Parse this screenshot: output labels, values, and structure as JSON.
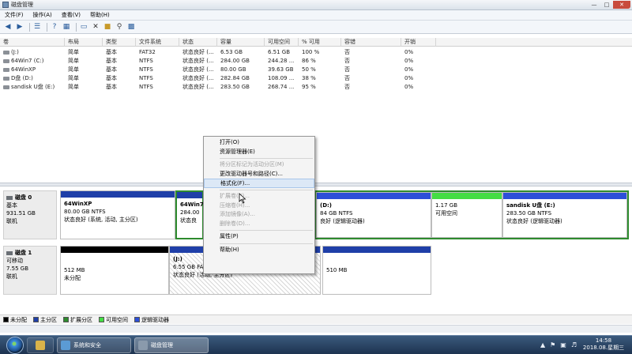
{
  "window": {
    "title": "磁盘管理",
    "controls": [
      "—",
      "□",
      "✕"
    ]
  },
  "menubar": [
    "文件(F)",
    "操作(A)",
    "查看(V)",
    "帮助(H)"
  ],
  "columns": [
    "卷",
    "布局",
    "类型",
    "文件系统",
    "状态",
    "容量",
    "可用空间",
    "% 可用",
    "容错",
    "开销"
  ],
  "volumes": [
    {
      "name": "(J:)",
      "layout": "简单",
      "type": "基本",
      "fs": "FAT32",
      "status": "状态良好 (...",
      "capacity": "6.53 GB",
      "free": "6.51 GB",
      "pct": "100 %",
      "fault": "否",
      "overhead": "0%"
    },
    {
      "name": "64Win7 (C:)",
      "layout": "简单",
      "type": "基本",
      "fs": "NTFS",
      "status": "状态良好 (...",
      "capacity": "284.00 GB",
      "free": "244.28 ...",
      "pct": "86 %",
      "fault": "否",
      "overhead": "0%"
    },
    {
      "name": "64WinXP",
      "layout": "简单",
      "type": "基本",
      "fs": "NTFS",
      "status": "状态良好 (...",
      "capacity": "80.00 GB",
      "free": "39.63 GB",
      "pct": "50 %",
      "fault": "否",
      "overhead": "0%"
    },
    {
      "name": "D盘 (D:)",
      "layout": "简单",
      "type": "基本",
      "fs": "NTFS",
      "status": "状态良好 (...",
      "capacity": "282.84 GB",
      "free": "108.09 ...",
      "pct": "38 %",
      "fault": "否",
      "overhead": "0%"
    },
    {
      "name": "sandisk U盘 (E:)",
      "layout": "简单",
      "type": "基本",
      "fs": "NTFS",
      "status": "状态良好 (...",
      "capacity": "283.50 GB",
      "free": "268.74 ...",
      "pct": "95 %",
      "fault": "否",
      "overhead": "0%"
    }
  ],
  "disk0": {
    "title": "磁盘 0",
    "type": "基本",
    "size": "931.51 GB",
    "state": "联机",
    "parts": [
      {
        "line1": "64WinXP",
        "line2": "80.00 GB NTFS",
        "line3": "状态良好 (系统, 活动, 主分区)"
      },
      {
        "line1": "64Win7",
        "line2": "284.00",
        "line3": "状态良"
      },
      {
        "line1": "(D:)",
        "line2": "84 GB NTFS",
        "line3": "良好 (逻辑驱动器)"
      },
      {
        "line1": "",
        "line2": "1.17 GB",
        "line3": "可用空间"
      },
      {
        "line1": "sandisk U盘  (E:)",
        "line2": "283.50 GB NTFS",
        "line3": "状态良好 (逻辑驱动器)"
      }
    ]
  },
  "disk1": {
    "title": "磁盘 1",
    "type": "可移动",
    "size": "7.55 GB",
    "state": "联机",
    "parts": [
      {
        "line1": "",
        "line2": "512 MB",
        "line3": "未分配"
      },
      {
        "line1": "(J:)",
        "line2": "6.55 GB FA",
        "line3": "状态良好 (活动, 主分区)"
      },
      {
        "line1": "",
        "line2": "510 MB",
        "line3": ""
      }
    ]
  },
  "legend": [
    "未分配",
    "主分区",
    "扩展分区",
    "可用空间",
    "逻辑驱动器"
  ],
  "legend_colors": [
    "#000000",
    "#1f3fa8",
    "#2e8b2e",
    "#44dd44",
    "#2d4fd8"
  ],
  "context_menu": {
    "group1": [
      {
        "label": "打开(O)",
        "disabled": false
      },
      {
        "label": "资源管理器(E)",
        "disabled": false
      }
    ],
    "group2": [
      {
        "label": "将分区标记为活动分区(M)",
        "disabled": true
      },
      {
        "label": "更改驱动器号和路径(C)...",
        "disabled": false
      },
      {
        "label": "格式化(F)...",
        "disabled": false,
        "highlighted": true
      }
    ],
    "group3": [
      {
        "label": "扩展卷(X)...",
        "disabled": true
      },
      {
        "label": "压缩卷(H)...",
        "disabled": true
      },
      {
        "label": "添加镜像(A)...",
        "disabled": true
      },
      {
        "label": "删除卷(D)...",
        "disabled": true
      }
    ],
    "group4": [
      {
        "label": "属性(P)",
        "disabled": false
      }
    ],
    "group5": [
      {
        "label": "帮助(H)",
        "disabled": false
      }
    ]
  },
  "taskbar": {
    "apps": [
      "系统和安全",
      "磁盘管理"
    ],
    "time": "14:58",
    "date": "2018.08.星期三"
  },
  "colors": {
    "primary_bar": "#1f3fa8",
    "logical_bar": "#2d4fd8",
    "free_bar": "#44dd44",
    "unalloc_bar": "#000000",
    "selection": "#2e8b2e"
  }
}
